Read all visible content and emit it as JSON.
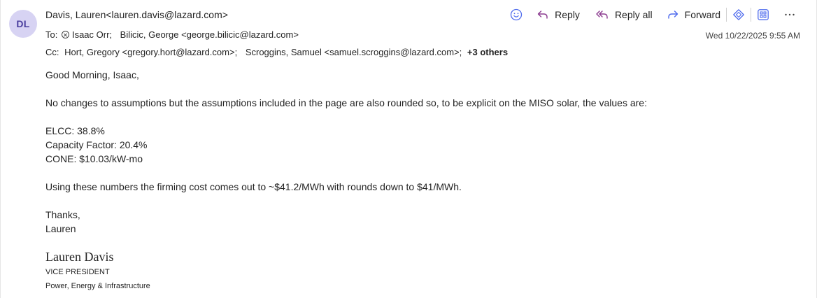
{
  "sender": {
    "initials": "DL",
    "display": "Davis, Lauren<lauren.davis@lazard.com>"
  },
  "to": {
    "label": "To:",
    "recipients": [
      "Isaac Orr;",
      "Bilicic, George <george.bilicic@lazard.com>"
    ]
  },
  "cc": {
    "label": "Cc:",
    "recipients": [
      "Hort, Gregory <gregory.hort@lazard.com>;",
      "Scroggins, Samuel <samuel.scroggins@lazard.com>;"
    ],
    "others": "+3 others"
  },
  "date": "Wed 10/22/2025 9:55 AM",
  "toolbar": {
    "emoji_icon": "emoji-icon",
    "reply": "Reply",
    "reply_all": "Reply all",
    "forward": "Forward",
    "accent_color": "#4f6bed"
  },
  "body": {
    "greeting": "Good Morning, Isaac,",
    "para1": "No changes to assumptions but the assumptions included in the page are also rounded so, to be explicit on the MISO solar, the values are:",
    "values": [
      "ELCC: 38.8%",
      "Capacity Factor: 20.4%",
      "CONE: $10.03/kW-mo"
    ],
    "para2": "Using these numbers the firming cost comes out to ~$41.2/MWh with rounds down to $41/MWh.",
    "closing": "Thanks,",
    "name": "Lauren"
  },
  "signature": {
    "name": "Lauren Davis",
    "title": "VICE PRESIDENT",
    "division": "Power, Energy & Infrastructure"
  },
  "colors": {
    "avatar_bg": "#d7d3f3",
    "avatar_fg": "#4b3f9e",
    "reply_all_icon": "#8b3a8f"
  }
}
